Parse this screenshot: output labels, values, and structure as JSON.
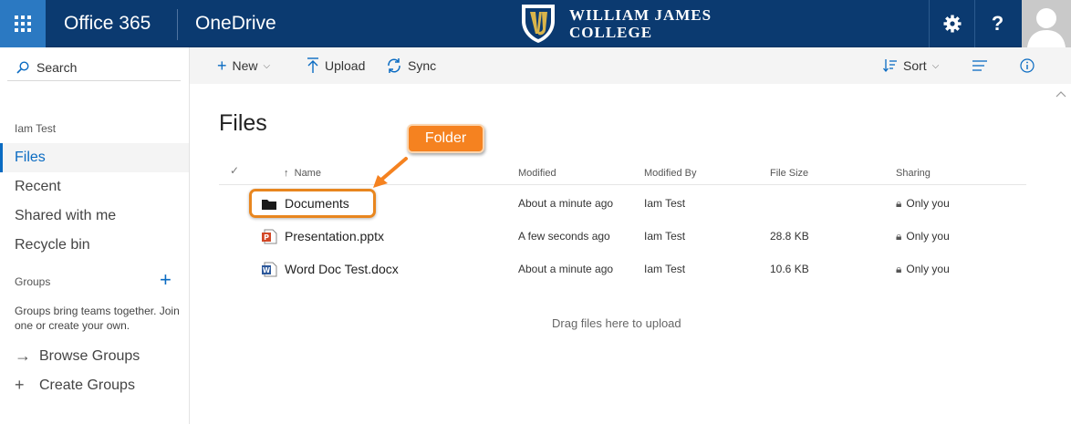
{
  "topbar": {
    "app_title": "Office 365",
    "app_name": "OneDrive",
    "logo_line1": "WILLIAM JAMES",
    "logo_line2": "COLLEGE",
    "help_label": "?"
  },
  "search": {
    "label": "Search"
  },
  "nav": {
    "user": "Iam Test",
    "items": [
      {
        "label": "Files",
        "active": true
      },
      {
        "label": "Recent"
      },
      {
        "label": "Shared with me"
      },
      {
        "label": "Recycle bin"
      }
    ],
    "groups_header": "Groups",
    "groups_desc": "Groups bring teams together. Join one or create your own.",
    "browse_groups": "Browse Groups",
    "create_groups": "Create Groups"
  },
  "commands": {
    "new": "New",
    "upload": "Upload",
    "sync": "Sync",
    "sort": "Sort"
  },
  "main": {
    "title": "Files",
    "columns": {
      "name": "Name",
      "modified": "Modified",
      "modified_by": "Modified By",
      "file_size": "File Size",
      "sharing": "Sharing"
    },
    "rows": [
      {
        "name": "Documents",
        "type": "folder",
        "modified": "About a minute ago",
        "modified_by": "Iam Test",
        "file_size": "",
        "sharing": "Only you"
      },
      {
        "name": "Presentation.pptx",
        "type": "pptx",
        "modified": "A few seconds ago",
        "modified_by": "Iam Test",
        "file_size": "28.8 KB",
        "sharing": "Only you"
      },
      {
        "name": "Word Doc Test.docx",
        "type": "docx",
        "modified": "About a minute ago",
        "modified_by": "Iam Test",
        "file_size": "10.6 KB",
        "sharing": "Only you"
      }
    ],
    "drop_hint": "Drag files here to upload"
  },
  "callout": {
    "label": "Folder"
  },
  "colors": {
    "topbar": "#0b3a70",
    "accent": "#0a6bc2",
    "waffle": "#2b79c2",
    "callout": "#f58220"
  }
}
